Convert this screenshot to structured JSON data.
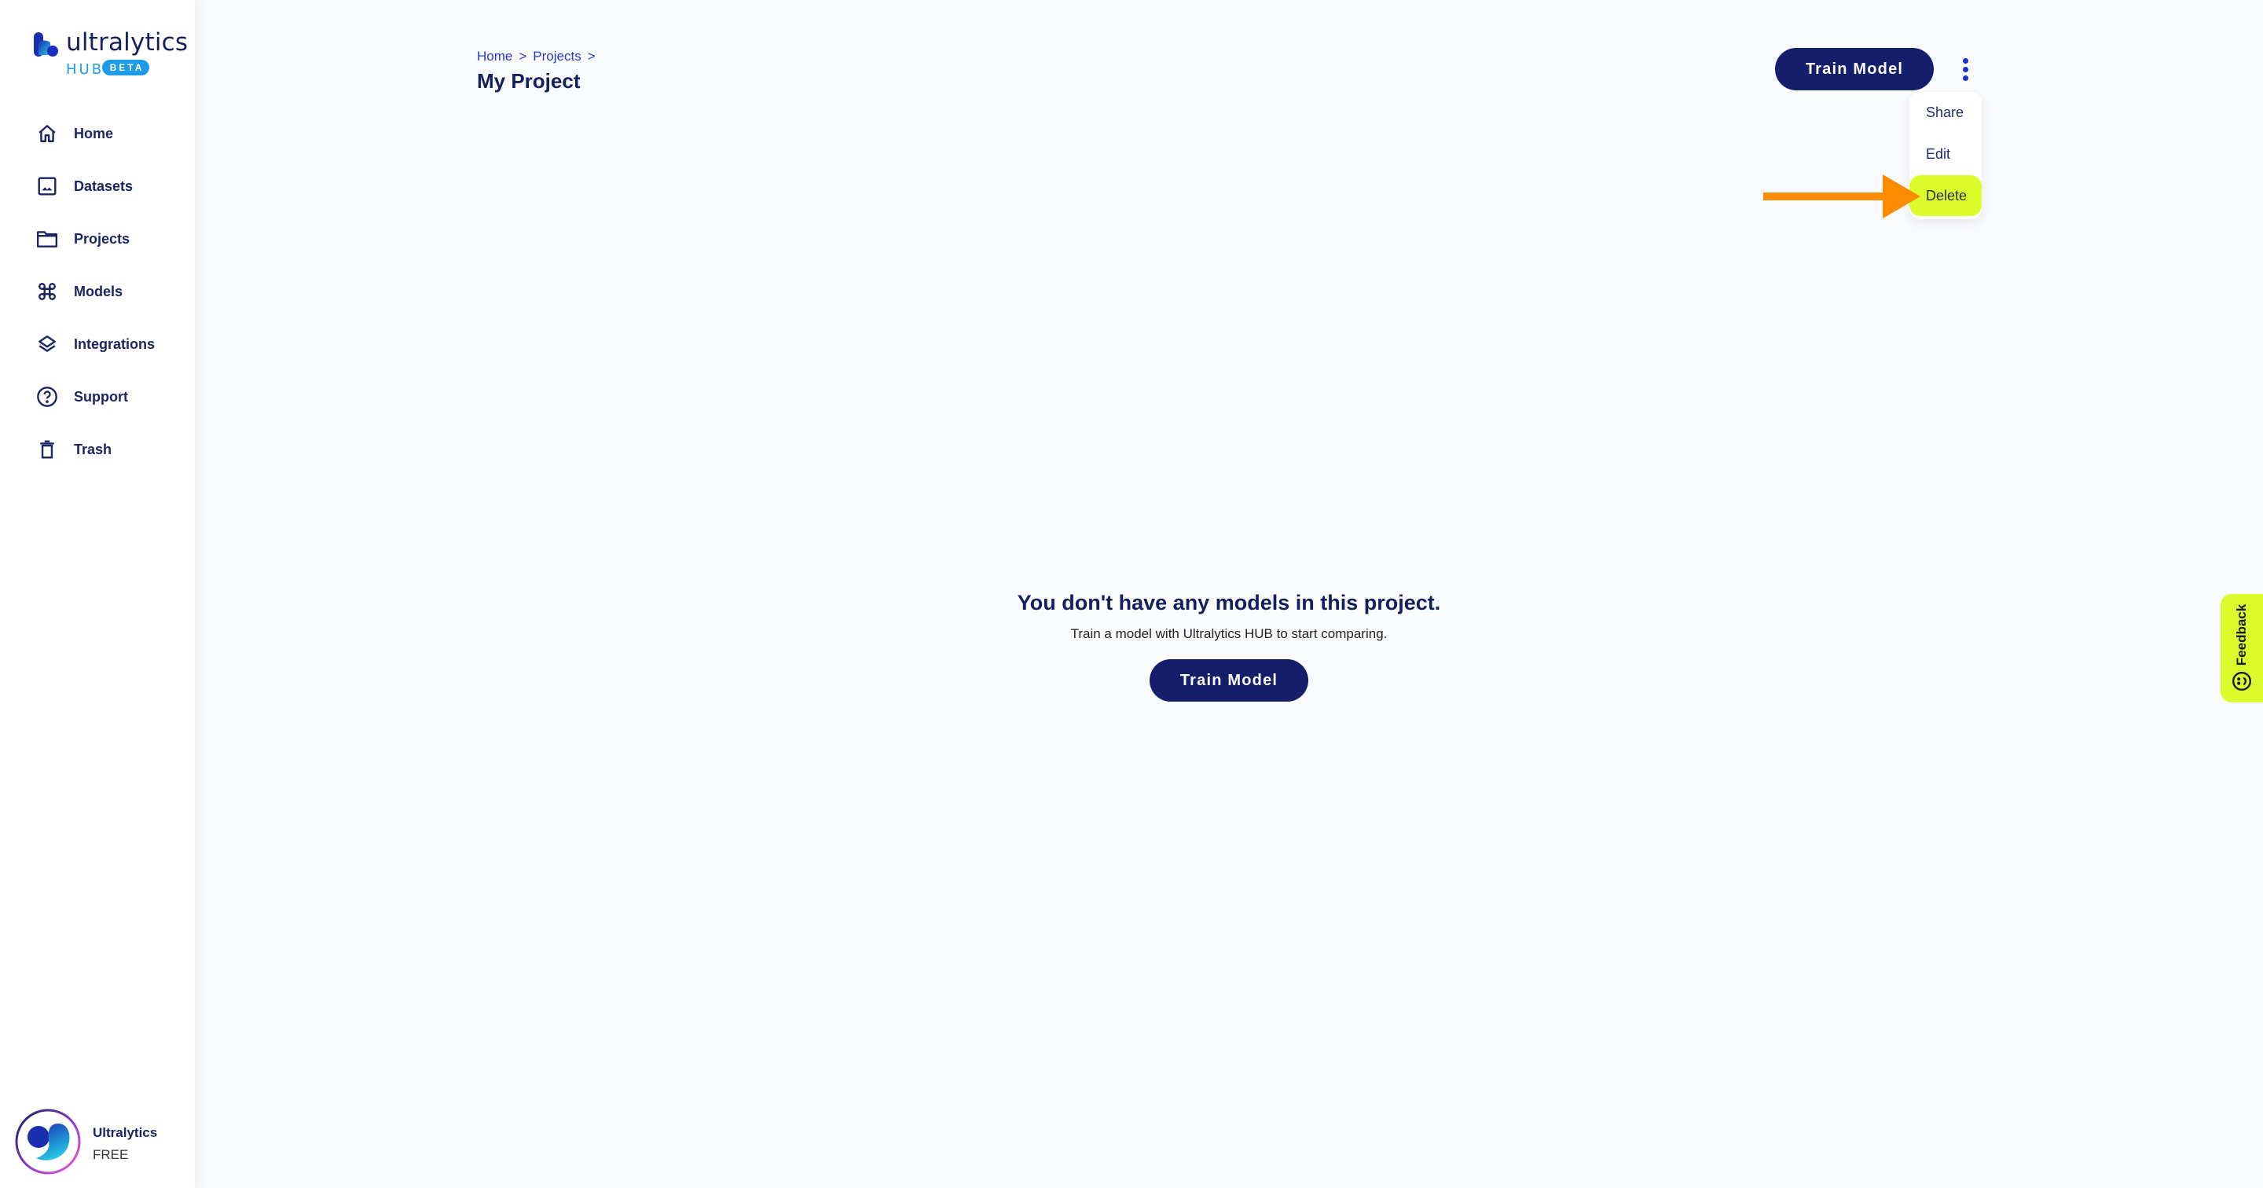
{
  "app": {
    "logo_word": "ultralytics",
    "logo_hub": "HUB",
    "logo_badge": "BETA"
  },
  "sidebar": {
    "items": [
      {
        "label": "Home",
        "icon": "home-icon"
      },
      {
        "label": "Datasets",
        "icon": "image-icon"
      },
      {
        "label": "Projects",
        "icon": "folder-icon"
      },
      {
        "label": "Models",
        "icon": "command-icon"
      },
      {
        "label": "Integrations",
        "icon": "layers-icon"
      },
      {
        "label": "Support",
        "icon": "help-circle-icon"
      },
      {
        "label": "Trash",
        "icon": "trash-icon"
      }
    ],
    "user": {
      "name": "Ultralytics",
      "plan": "FREE"
    }
  },
  "header": {
    "breadcrumb": [
      {
        "label": "Home"
      },
      {
        "label": "Projects"
      }
    ],
    "breadcrumb_separator": ">",
    "title": "My Project",
    "train_button": "Train Model"
  },
  "menu": {
    "items": [
      {
        "label": "Share",
        "highlighted": false
      },
      {
        "label": "Edit",
        "highlighted": false
      },
      {
        "label": "Delete",
        "highlighted": true
      }
    ]
  },
  "empty_state": {
    "title": "You don't have any models in this project.",
    "subtitle": "Train a model with Ultralytics HUB to start comparing.",
    "button": "Train Model"
  },
  "feedback": {
    "label": "Feedback"
  },
  "colors": {
    "primary": "#131f6b",
    "accent_blue": "#1e9be8",
    "highlight": "#dcfb2a",
    "annotation_arrow": "#fb8c00",
    "background": "#f9fafc"
  }
}
